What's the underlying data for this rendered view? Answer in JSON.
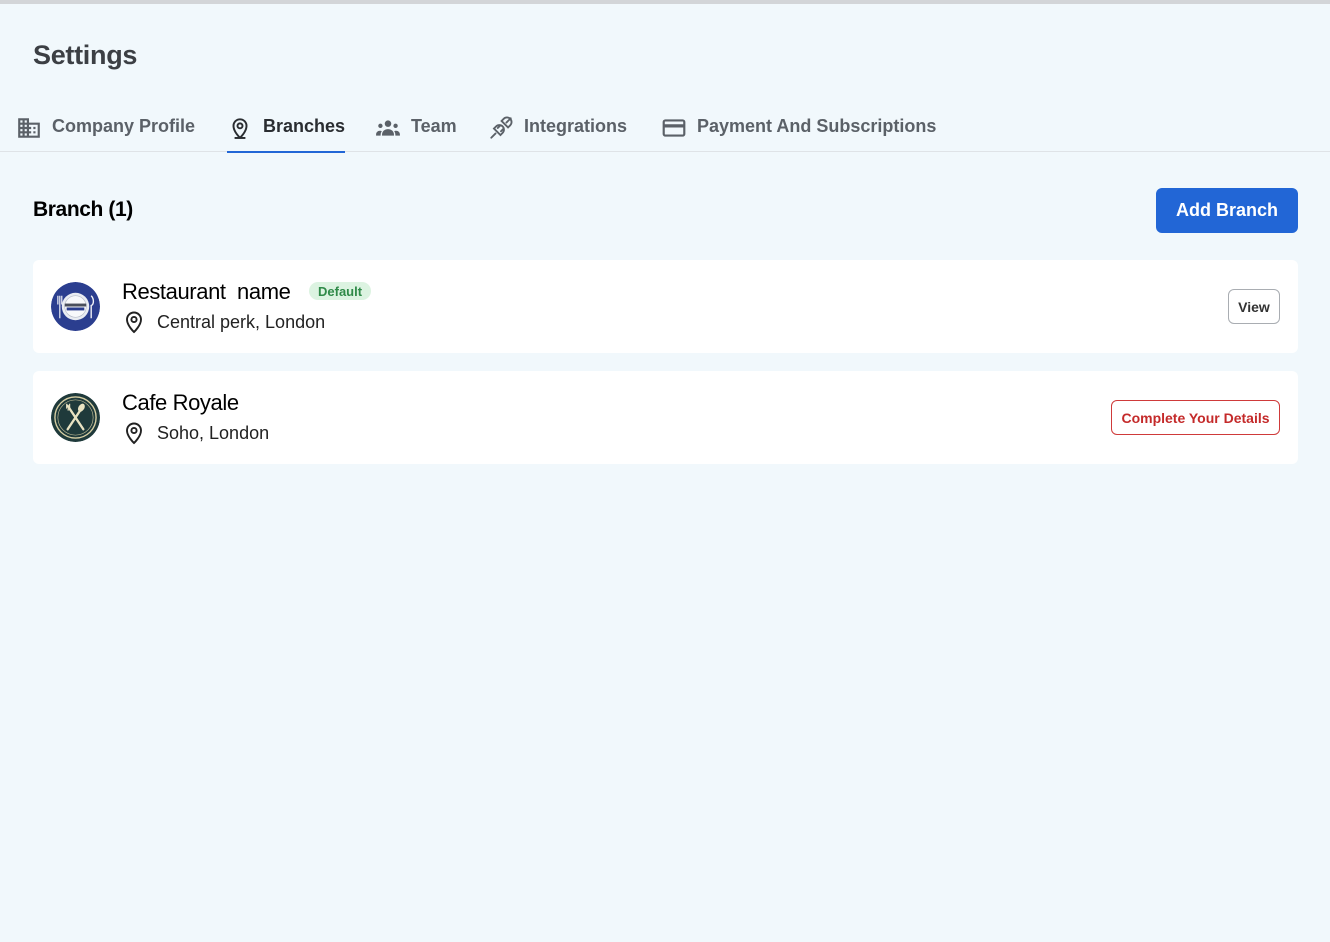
{
  "page": {
    "title": "Settings"
  },
  "tabs": [
    {
      "label": "Company Profile",
      "icon": "building-icon",
      "active": false
    },
    {
      "label": "Branches",
      "icon": "location-pin-icon",
      "active": true
    },
    {
      "label": "Team",
      "icon": "team-icon",
      "active": false
    },
    {
      "label": "Integrations",
      "icon": "plug-icon",
      "active": false
    },
    {
      "label": "Payment And Subscriptions",
      "icon": "credit-card-icon",
      "active": false
    }
  ],
  "colors": {
    "accent": "#2266d6",
    "background": "#f1f8fc",
    "danger": "#c42a2a",
    "success": "#2f8a48"
  },
  "branches": {
    "heading": "Branch (1)",
    "add_label": "Add Branch",
    "items": [
      {
        "name": "Restaurant  name",
        "badge": "Default",
        "location": "Central perk, London",
        "action": "View",
        "avatar": "restaurant-logo"
      },
      {
        "name": "Cafe Royale",
        "location": "Soho, London",
        "action": "Complete Your Details",
        "avatar": "cafe-logo"
      }
    ]
  }
}
